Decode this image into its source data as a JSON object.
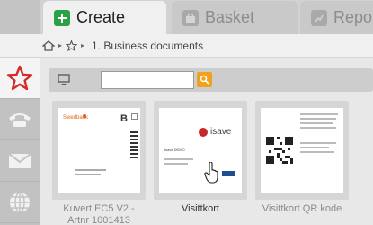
{
  "tabs": [
    {
      "label": "Create",
      "icon": "plus-icon",
      "active": true
    },
    {
      "label": "Basket",
      "icon": "basket-icon",
      "active": false
    },
    {
      "label": "Report",
      "icon": "report-icon",
      "active": false
    }
  ],
  "breadcrumb": {
    "text": "1. Business documents"
  },
  "rail": [
    {
      "icon": "star-icon",
      "active": true
    },
    {
      "icon": "phone-icon",
      "active": false
    },
    {
      "icon": "mail-icon",
      "active": false
    },
    {
      "icon": "globe-icon",
      "active": false
    }
  ],
  "search": {
    "placeholder": "",
    "value": ""
  },
  "cards": [
    {
      "caption": "Kuvert EC5 V2 - Artnr 1001413",
      "thumb": {
        "logo": "Swedbank",
        "letter": "B"
      }
    },
    {
      "caption": "Visittkort",
      "thumb": {
        "brand": "isave",
        "line1": "Isave DEMO"
      }
    },
    {
      "caption": "Visittkort QR kode",
      "thumb": {}
    }
  ],
  "colors": {
    "accent_green": "#2aa146",
    "search_orange": "#f0a21c",
    "star_red": "#d52a2a"
  }
}
